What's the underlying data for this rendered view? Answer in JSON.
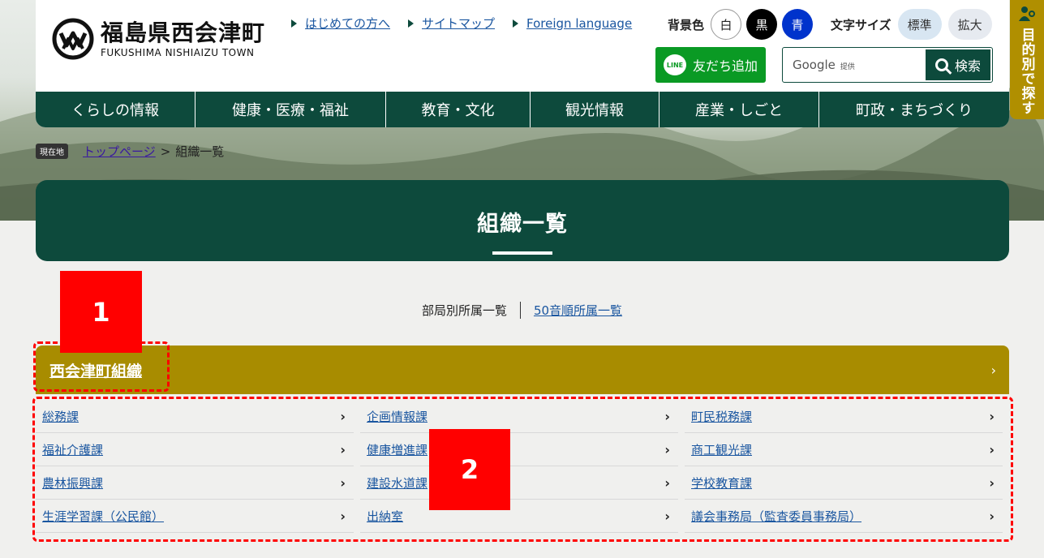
{
  "site": {
    "name_jp": "福島県西会津町",
    "name_en": "FUKUSHIMA NISHIAIZU TOWN"
  },
  "top_links": [
    "はじめての方へ",
    "サイトマップ",
    "Foreign language"
  ],
  "bg_color": {
    "label": "背景色",
    "options": [
      "白",
      "黒",
      "青"
    ]
  },
  "font_size": {
    "label": "文字サイズ",
    "options": [
      "標準",
      "拡大"
    ]
  },
  "line_button": {
    "icon_text": "LINE",
    "label": "友だち追加"
  },
  "search": {
    "provider": "Google",
    "provider_note": "提供",
    "button": "検索"
  },
  "global_nav": [
    "くらしの情報",
    "健康・医療・福祉",
    "教育・文化",
    "観光情報",
    "産業・しごと",
    "町政・まちづくり"
  ],
  "side_tab": "目的別で探す",
  "breadcrumb": {
    "badge": "現在地",
    "home": "トップページ",
    "sep": ">",
    "current": "組織一覧"
  },
  "page_title": "組織一覧",
  "view_tabs": {
    "current": "部局別所属一覧",
    "alt": "50音順所属一覧"
  },
  "org": {
    "name": "西会津町組織",
    "arrow": "›",
    "items": [
      "総務課",
      "企画情報課",
      "町民税務課",
      "福祉介護課",
      "健康増進課",
      "商工観光課",
      "農林振興課",
      "建設水道課",
      "学校教育課",
      "生涯学習課（公民館）",
      "出納室",
      "議会事務局（監査委員事務局）"
    ],
    "chevron": "›"
  },
  "annotations": [
    "1",
    "2"
  ],
  "colors": {
    "primary": "#0d4a3c",
    "gold": "#a88c00",
    "marker": "#ff0000",
    "line": "#0a9a24"
  }
}
